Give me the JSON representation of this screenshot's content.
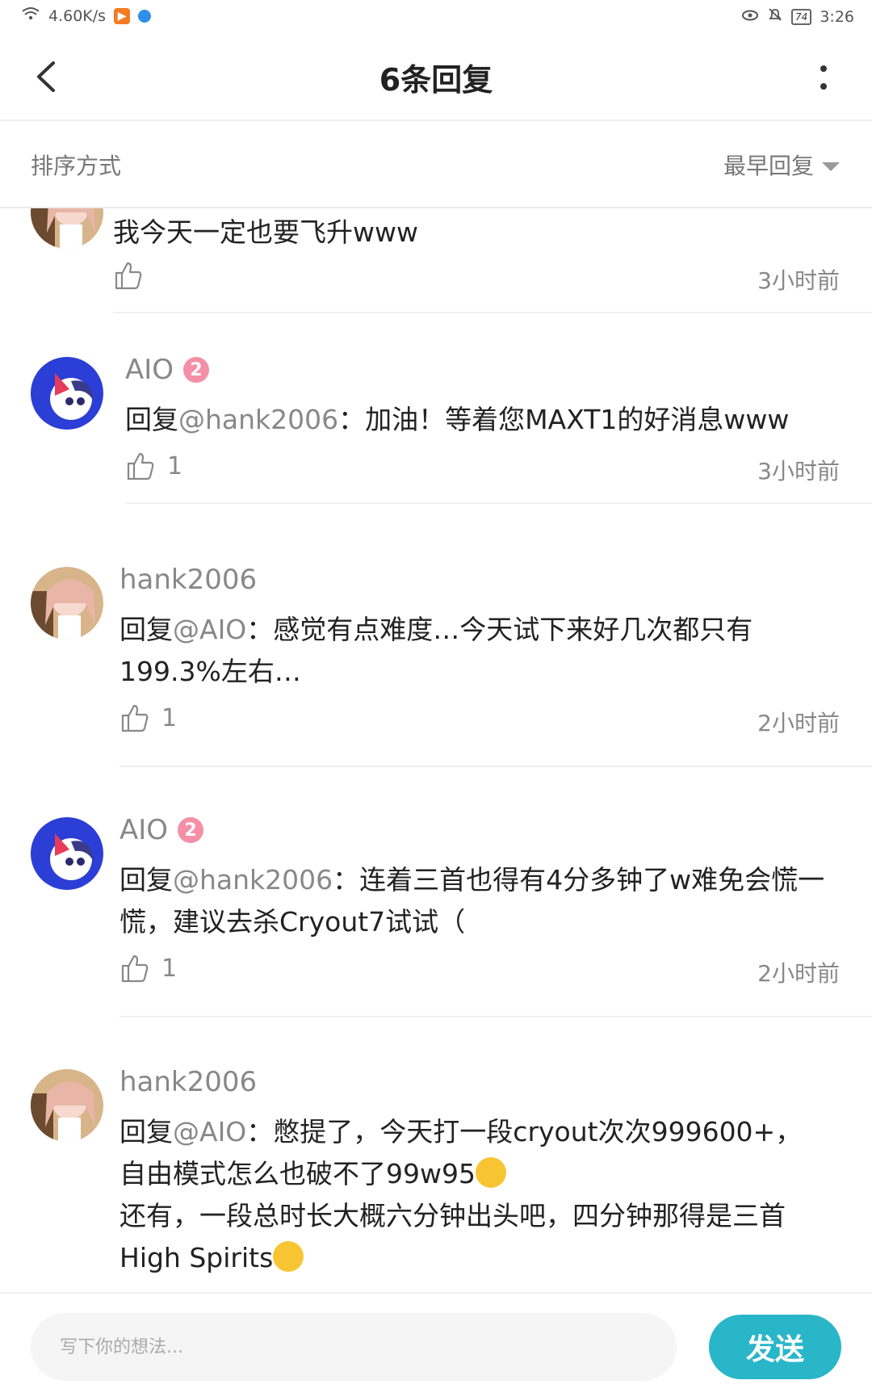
{
  "status_bar": {
    "network_speed": "4.60K/s",
    "battery": "74",
    "time": "3:26"
  },
  "header": {
    "title": "6条回复"
  },
  "sort": {
    "label": "排序方式",
    "selected": "最早回复"
  },
  "comments": [
    {
      "username": "",
      "reply_prefix": "",
      "mention": "",
      "body": "我今天一定也要飞升www",
      "likes": "",
      "time": "3小时前"
    },
    {
      "username": "AIO",
      "badge": "2",
      "reply_prefix": "回复",
      "mention": "@hank2006",
      "body": "：加油！等着您MAXT1的好消息www",
      "likes": "1",
      "time": "3小时前"
    },
    {
      "username": "hank2006",
      "reply_prefix": "回复",
      "mention": "@AIO",
      "body": "：感觉有点难度…今天试下来好几次都只有199.3%左右…",
      "likes": "1",
      "time": "2小时前"
    },
    {
      "username": "AIO",
      "badge": "2",
      "reply_prefix": "回复",
      "mention": "@hank2006",
      "body": "：连着三首也得有4分多钟了w难免会慌一慌，建议去杀Cryout7试试（",
      "likes": "1",
      "time": "2小时前"
    },
    {
      "username": "hank2006",
      "reply_prefix": "回复",
      "mention": "@AIO",
      "body_line1": "：憋提了，今天打一段cryout次次999600+，",
      "body_line2": "自由模式怎么也破不了99w95",
      "body_line3": "还有，一段总时长大概六分钟出头吧，四分钟那得是三首",
      "body_line4": "High Spirits"
    }
  ],
  "input": {
    "placeholder": "写下你的想法..."
  },
  "send_label": "发送",
  "colors": {
    "accent": "#28b6c8",
    "badge": "#f48fa7"
  }
}
